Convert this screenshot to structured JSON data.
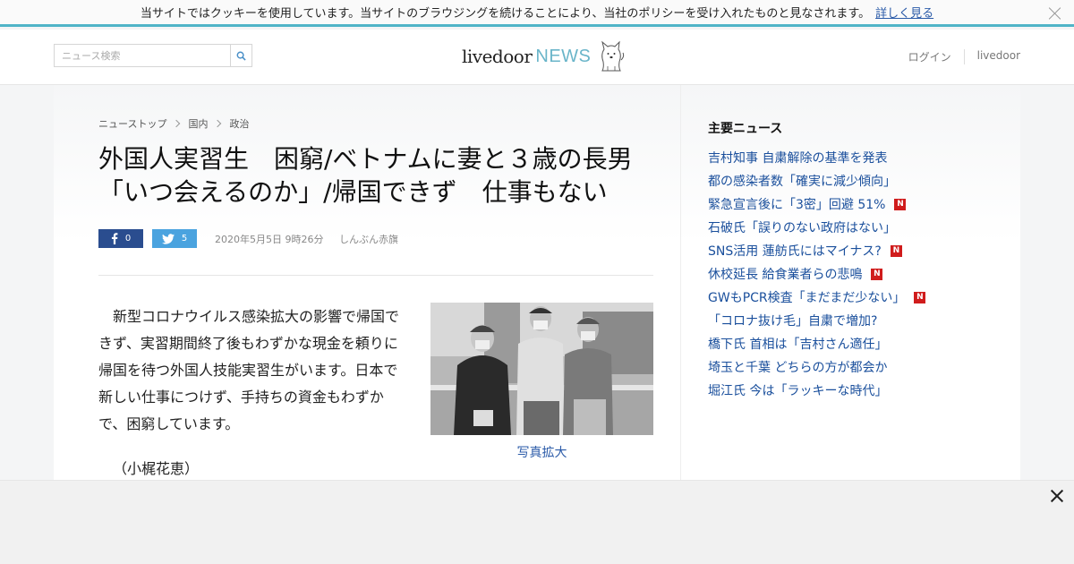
{
  "cookie": {
    "message": "当サイトではクッキーを使用しています。当サイトのブラウジングを続けることにより、当社のポリシーを受け入れたものと見なされます。",
    "link": "詳しく見る"
  },
  "header": {
    "search_placeholder": "ニュース検索",
    "logo_main": "livedoor",
    "logo_news": "NEWS",
    "login": "ログイン",
    "livedoor_link": "livedoor"
  },
  "breadcrumb": [
    "ニューストップ",
    "国内",
    "政治"
  ],
  "article": {
    "title_line1": "外国人実習生　困窮/ベトナムに妻と３歳の長男",
    "title_line2": "「いつ会えるのか」/帰国できず　仕事もない",
    "fb_count": "0",
    "tw_count": "5",
    "date": "2020年5月5日 9時26分",
    "source": "しんぶん赤旗",
    "body": "新型コロナウイルス感染拡大の影響で帰国できず、実習期間終了後もわずかな現金を頼りに帰国を待つ外国人技能実習生がいます。日本で新しい仕事につけず、手持ちの資金もわずかで、困窮しています。",
    "author": "（小梶花恵）",
    "photo_caption": "写真拡大"
  },
  "sidebar": {
    "heading": "主要ニュース",
    "items": [
      {
        "label": "吉村知事 自粛解除の基準を発表",
        "new": false
      },
      {
        "label": "都の感染者数「確実に減少傾向」",
        "new": false
      },
      {
        "label": "緊急宣言後に「3密」回避 51%",
        "new": true
      },
      {
        "label": "石破氏「誤りのない政府はない」",
        "new": false
      },
      {
        "label": "SNS活用 蓮舫氏にはマイナス?",
        "new": true
      },
      {
        "label": "休校延長 給食業者らの悲鳴",
        "new": true
      },
      {
        "label": "GWもPCR検査「まだまだ少ない」",
        "new": true
      },
      {
        "label": "「コロナ抜け毛」自粛で増加?",
        "new": false
      },
      {
        "label": "橋下氏 首相は「吉村さん適任」",
        "new": false
      },
      {
        "label": "埼玉と千葉 どちらの方が都会か",
        "new": false
      },
      {
        "label": "堀江氏 今は「ラッキーな時代」",
        "new": false
      }
    ],
    "badge_text": "N"
  },
  "colors": {
    "accent": "#50b4c8",
    "link": "#1a4f9c",
    "facebook": "#2a4d8f",
    "twitter": "#4aa3df",
    "new_badge": "#d01c1c"
  }
}
